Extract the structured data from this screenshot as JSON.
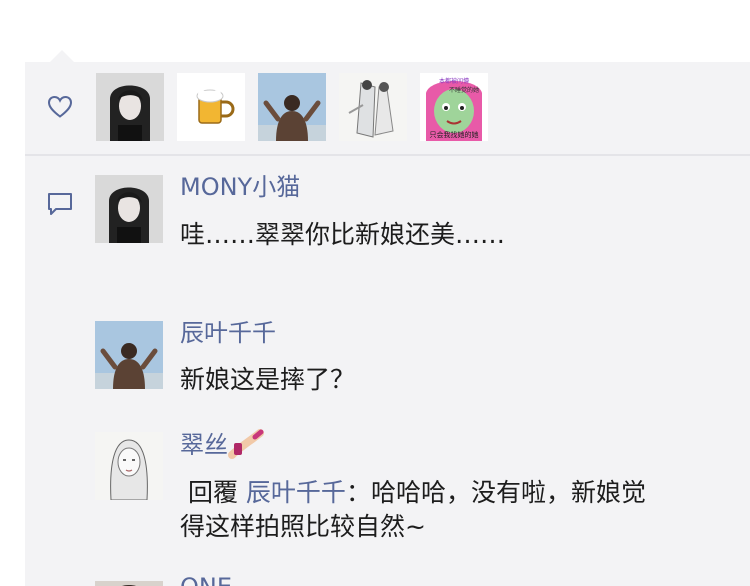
{
  "likes": {
    "icon": "heart-outline-icon",
    "avatars": [
      {
        "icon": "woman-portrait-photo"
      },
      {
        "icon": "beer-mug-sticker"
      },
      {
        "icon": "woman-back-sky-photo"
      },
      {
        "icon": "costume-drama-sketch"
      },
      {
        "icon": "cartoon-meme-sticker"
      }
    ],
    "meme_lines": [
      "本都被问懵",
      "不睡觉的她",
      "只会我找她的她"
    ]
  },
  "comments": {
    "icon": "comment-bubble-icon",
    "items": [
      {
        "name": "MONY小猫",
        "text": "哇……翠翠你比新娘还美……"
      },
      {
        "name": "辰叶千千",
        "text": "新娘这是摔了？"
      },
      {
        "name": "翠丝",
        "name_emoji": "nail-polish-emoji",
        "reply_prefix": "回覆",
        "reply_to": "辰叶千千",
        "text_line1": "：哈哈哈，没有啦，新娘觉",
        "text_line2": "得这样拍照比较自然~"
      },
      {
        "name": "ONE"
      }
    ]
  },
  "colors": {
    "panel": "#f3f3f5",
    "name": "#57689a",
    "text": "#1d1d1d",
    "icon": "#57689a"
  }
}
